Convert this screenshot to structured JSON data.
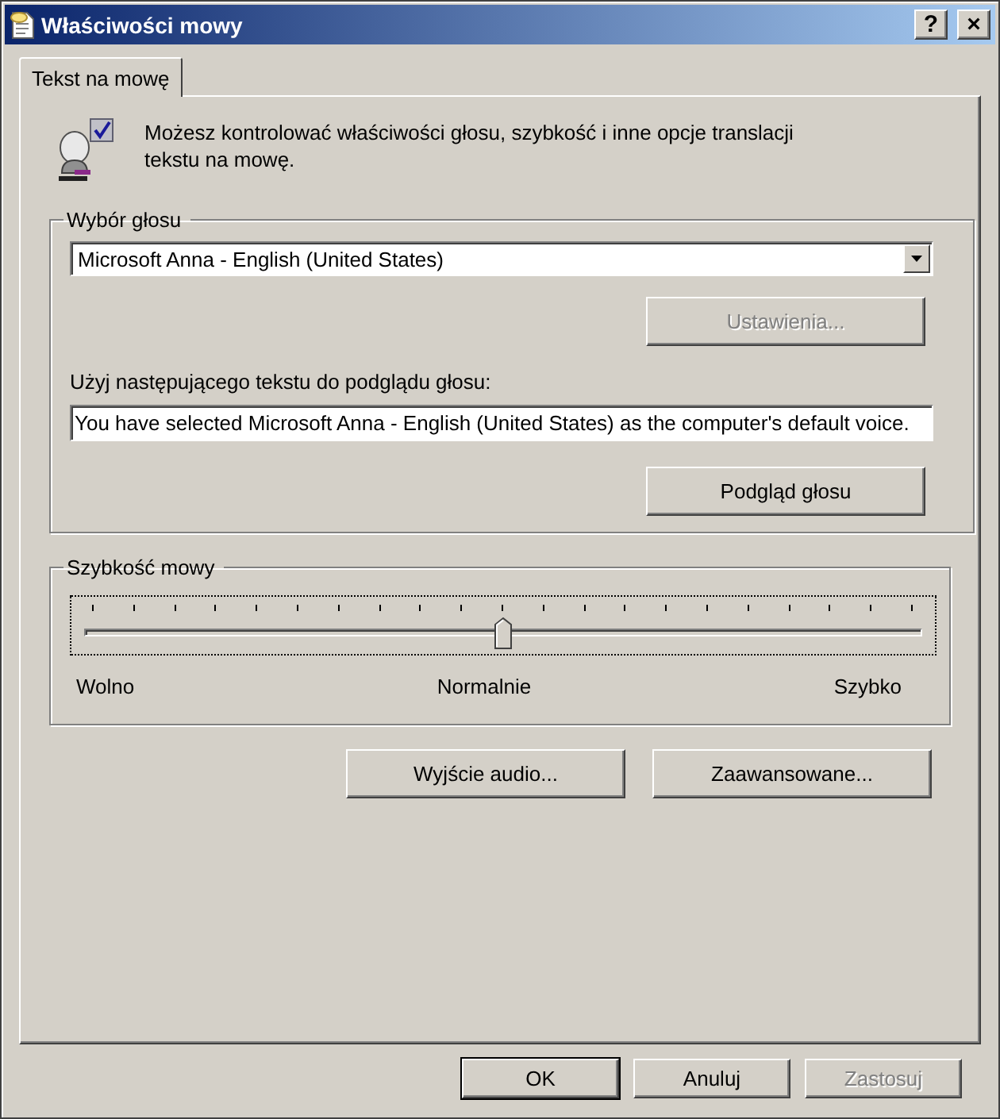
{
  "window": {
    "title": "Właściwości mowy",
    "help_button": "?",
    "close_button": "×"
  },
  "tabs": [
    {
      "label": "Tekst na mowę",
      "selected": true
    }
  ],
  "intro": "Możesz kontrolować właściwości głosu, szybkość i inne opcje translacji tekstu na mowę.",
  "voice_group": {
    "title": "Wybór głosu",
    "voice_select": {
      "value": "Microsoft Anna - English (United States)"
    },
    "settings_button": {
      "label": "Ustawienia...",
      "disabled": true
    },
    "preview_label": "Użyj następującego tekstu do podglądu głosu:",
    "preview_text": {
      "value": "You have selected Microsoft Anna - English (United States) as the computer's default voice."
    },
    "preview_button": {
      "label": "Podgląd głosu",
      "disabled": false
    }
  },
  "rate_group": {
    "title": "Szybkość mowy",
    "slider": {
      "level": 0.5
    },
    "labels": [
      "Wolno",
      "Normalnie",
      "Szybko"
    ]
  },
  "buttons": [
    {
      "label": "Wyjście audio...",
      "disabled": false
    },
    {
      "label": "Zaawansowane...",
      "disabled": false
    }
  ],
  "dialog_buttons": [
    {
      "label": "OK",
      "default": true,
      "disabled": false
    },
    {
      "label": "Anuluj",
      "default": false,
      "disabled": false
    },
    {
      "label": "Zastosuj",
      "default": false,
      "disabled": true
    }
  ]
}
